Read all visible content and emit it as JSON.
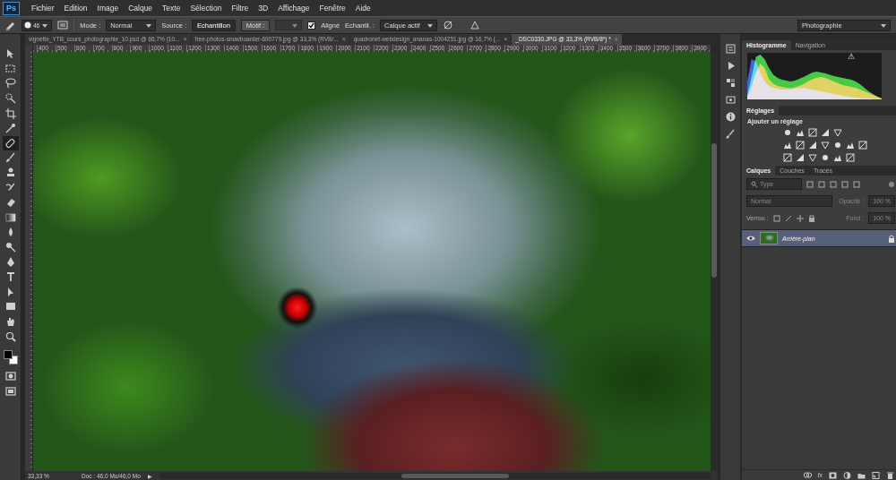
{
  "app": {
    "logo": "Ps"
  },
  "menu": [
    "Fichier",
    "Edition",
    "Image",
    "Calque",
    "Texte",
    "Sélection",
    "Filtre",
    "3D",
    "Affichage",
    "Fenêtre",
    "Aide"
  ],
  "options_bar": {
    "size": "46",
    "mode_label": "Mode :",
    "mode": "Normal",
    "source_label": "Source :",
    "source_buttons": [
      {
        "label": "Echantillon",
        "selected": true
      },
      {
        "label": "Motif :",
        "selected": false
      }
    ],
    "aligned": {
      "label": "Aligné",
      "checked": true
    },
    "sample_label": "Echantil. :",
    "sample": "Calque actif",
    "workspace": "Photographie"
  },
  "tabs": [
    {
      "label": "vignette_YTB_cours_photographie_10.psd @ 66,7% (10...",
      "selected": false
    },
    {
      "label": "free-photos-snowboarder-690779.jpg @ 33,3% (RVB/...",
      "selected": false
    },
    {
      "label": "quadronet-webdesign_ananas-1004251.jpg @ 16,7% (...",
      "selected": false
    },
    {
      "label": "_DSC0330.JPG @ 33,3% (RVB/8*) *",
      "selected": true
    }
  ],
  "tab_close": "×",
  "ruler": [
    "400",
    "500",
    "600",
    "700",
    "800",
    "900",
    "1000",
    "1100",
    "1200",
    "1300",
    "1400",
    "1500",
    "1600",
    "1700",
    "1800",
    "1900",
    "2000",
    "2100",
    "2200",
    "2300",
    "2400",
    "2500",
    "2600",
    "2700",
    "2800",
    "2900",
    "3000",
    "3100",
    "3200",
    "3300",
    "3400",
    "3500",
    "3600",
    "3700",
    "3800",
    "3900"
  ],
  "tools": [
    {
      "selected": false
    },
    {
      "selected": false
    },
    {
      "selected": false
    },
    {
      "selected": false
    },
    {
      "selected": false
    },
    {
      "selected": false
    },
    {
      "selected": true
    },
    {
      "selected": false
    },
    {
      "selected": false
    },
    {
      "selected": false
    },
    {
      "selected": false
    },
    {
      "selected": false
    },
    {
      "selected": false
    },
    {
      "selected": false
    },
    {
      "selected": false
    },
    {
      "selected": false
    },
    {
      "selected": false
    },
    {
      "selected": false
    },
    {
      "selected": false
    },
    {
      "selected": false
    }
  ],
  "colors": {
    "foreground": "#000000",
    "background": "#ffffff"
  },
  "status_bar": {
    "zoom": "33,33 %",
    "doc": "Doc : 46,0 Mo/46,0 Mo",
    "arrow": "▶"
  },
  "histogram": {
    "tabs": [
      {
        "label": "Histogramme",
        "selected": true
      },
      {
        "label": "Navigation",
        "selected": false
      }
    ],
    "warning": "⚠",
    "series": [
      {
        "color": "#d42a2a",
        "values": [
          5,
          30,
          60,
          80,
          70,
          45,
          35,
          30,
          28,
          26,
          25,
          27,
          30,
          34,
          40,
          45,
          48,
          50,
          48,
          44,
          40,
          36,
          32,
          30,
          28,
          26,
          22,
          18,
          14,
          10,
          6,
          3
        ]
      },
      {
        "color": "#2fc42f",
        "values": [
          10,
          50,
          95,
          100,
          90,
          70,
          55,
          48,
          44,
          42,
          40,
          42,
          46,
          50,
          55,
          60,
          62,
          60,
          58,
          55,
          52,
          50,
          48,
          46,
          44,
          40,
          34,
          26,
          18,
          12,
          6,
          2
        ]
      },
      {
        "color": "#2a52d8",
        "values": [
          40,
          90,
          85,
          60,
          40,
          30,
          26,
          24,
          22,
          22,
          22,
          24,
          25,
          26,
          24,
          22,
          20,
          18,
          16,
          14,
          12,
          10,
          8,
          6,
          5,
          4,
          3,
          2,
          2,
          1,
          1,
          0
        ]
      }
    ]
  },
  "adjustments": {
    "tabs": [
      {
        "label": "Réglages",
        "selected": true
      }
    ],
    "subtitle": "Ajouter un réglage"
  },
  "layers": {
    "tabs": [
      {
        "label": "Calques",
        "selected": true
      },
      {
        "label": "Couches",
        "selected": false
      },
      {
        "label": "Tracés",
        "selected": false
      }
    ],
    "filter": "Type",
    "blend": "Normal",
    "opacity_label": "Opacité :",
    "opacity": "100 %",
    "lock_label": "Verrou :",
    "fill_label": "Fond :",
    "fill": "100 %",
    "items": [
      {
        "name": "Arrière-plan",
        "visible": true,
        "selected": true,
        "locked": true
      }
    ],
    "footer_fx": "fx"
  }
}
